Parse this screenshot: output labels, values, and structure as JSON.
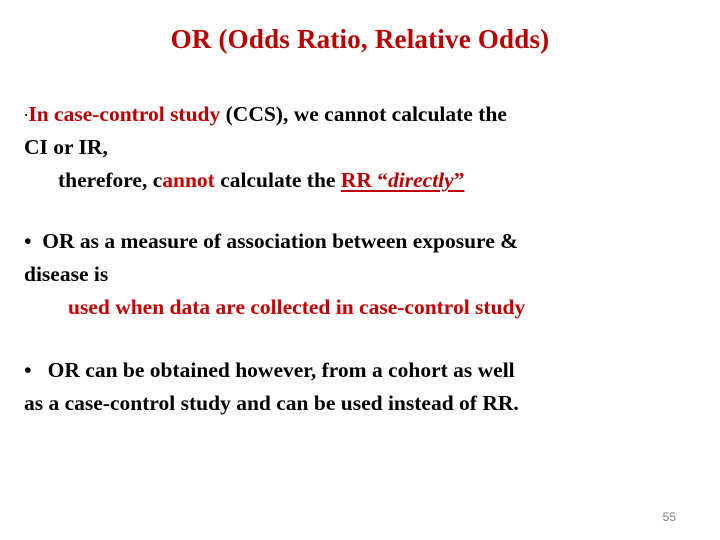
{
  "slide": {
    "title": "OR (Odds Ratio, Relative Odds)",
    "slide_number": "55",
    "colors": {
      "title_red": "#C00000",
      "accent_red": "#CC0000",
      "body_black": "#000000",
      "slide_number_gray": "#808080",
      "background": "#FFFFFF"
    },
    "bullets": [
      {
        "marker": "·",
        "marker_style": "small-dot",
        "lines": [
          {
            "indent": 0,
            "segments": [
              {
                "text": "In case-control study",
                "color": "red"
              },
              {
                "text": " (CCS), we cannot calculate the",
                "color": "black"
              }
            ]
          },
          {
            "indent": 0,
            "segments": [
              {
                "text": "CI or IR,",
                "color": "black"
              }
            ]
          },
          {
            "indent": 1,
            "segments": [
              {
                "text": "therefore, c",
                "color": "black"
              },
              {
                "text": "annot",
                "color": "red"
              },
              {
                "text": " calculate the ",
                "color": "black"
              },
              {
                "text": "RR ",
                "color": "red",
                "underline": true
              },
              {
                "text": "“directly”",
                "color": "red",
                "underline": true,
                "italic_part": "directly"
              }
            ]
          }
        ]
      },
      {
        "marker": "•",
        "marker_style": "large-dot",
        "lines": [
          {
            "indent": 0,
            "segments": [
              {
                "text": "OR as a measure of association between exposure &",
                "color": "black"
              }
            ]
          },
          {
            "indent": 0,
            "segments": [
              {
                "text": "disease is",
                "color": "black"
              }
            ]
          },
          {
            "indent": 2,
            "segments": [
              {
                "text": "used when data are collected in case-control study",
                "color": "red"
              }
            ]
          }
        ]
      },
      {
        "marker": "•",
        "marker_style": "large-dot",
        "lines": [
          {
            "indent": 0,
            "segments": [
              {
                "text": "OR can be obtained however, from a cohort  as well",
                "color": "black"
              }
            ]
          },
          {
            "indent": 0,
            "segments": [
              {
                "text": "as a case-control study and can be used instead of RR.",
                "color": "black"
              }
            ]
          }
        ]
      }
    ],
    "text": {
      "b1_l1_red": "In case-control study",
      "b1_l1_black": " (CCS), we cannot calculate the",
      "b1_l2": "CI or IR,",
      "b1_l3_a": "therefore, c",
      "b1_l3_b": "annot",
      "b1_l3_c": " calculate the ",
      "b1_l3_rr": "RR ",
      "b1_l3_quote_open": "“",
      "b1_l3_directly": "directly",
      "b1_l3_quote_close": "”",
      "b2_marker": "•",
      "b2_l1": "OR as a measure of association between exposure &",
      "b2_l2": "disease is",
      "b2_l3": "used when data are collected in case-control study",
      "b3_marker": "•",
      "b3_l1": "OR can be obtained however, from a cohort  as well",
      "b3_l2": "as a case-control study and can be used instead of RR.",
      "b1_marker": "·"
    }
  }
}
